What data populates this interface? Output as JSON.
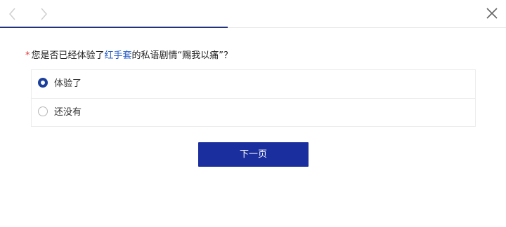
{
  "nav": {
    "back_icon": "chevron-left-icon",
    "forward_icon": "chevron-right-icon",
    "close_icon": "close-icon"
  },
  "progress": {
    "fraction": 0.45,
    "color": "#22337a"
  },
  "question": {
    "required_marker": "*",
    "text_before": "您是否已经体验了",
    "highlight": "红手套",
    "text_after": "的私语剧情“赐我以痛”？"
  },
  "options": [
    {
      "label": "体验了",
      "selected": true
    },
    {
      "label": "还没有",
      "selected": false
    }
  ],
  "next_button": {
    "label": "下一页",
    "color": "#1a2e9e"
  }
}
